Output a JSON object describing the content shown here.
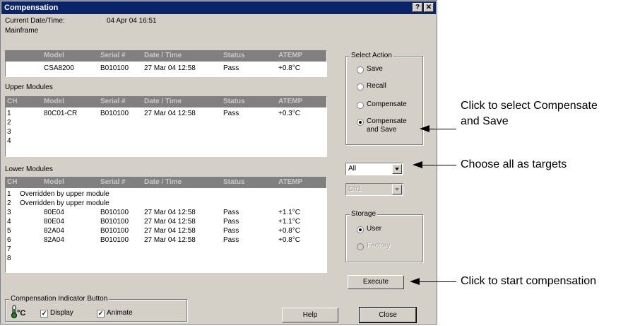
{
  "window": {
    "title": "Compensation",
    "help_glyph": "?",
    "close_glyph": "✕"
  },
  "datetime": {
    "label": "Current Date/Time:",
    "value": "04 Apr 04 16:51"
  },
  "mainframe": {
    "label": "Mainframe",
    "headers": [
      "Model",
      "Serial #",
      "Date / Time",
      "Status",
      "ATEMP"
    ],
    "rows": [
      [
        "CSA8200",
        "B010100",
        "27 Mar 04 12:58",
        "Pass",
        "+0.8°C"
      ]
    ]
  },
  "upper": {
    "label": "Upper Modules",
    "headers": [
      "CH",
      "Model",
      "Serial #",
      "Date / Time",
      "Status",
      "ATEMP"
    ],
    "rows": [
      [
        "1",
        "80C01-CR",
        "B010100",
        "27 Mar 04 12:58",
        "Pass",
        "+0.3°C"
      ],
      [
        "2",
        "",
        "",
        "",
        "",
        ""
      ],
      [
        "3",
        "",
        "",
        "",
        "",
        ""
      ],
      [
        "4",
        "",
        "",
        "",
        "",
        ""
      ]
    ]
  },
  "lower": {
    "label": "Lower Modules",
    "headers": [
      "CH",
      "Model",
      "Serial #",
      "Date / Time",
      "Status",
      "ATEMP"
    ],
    "overridden": "Overridden by upper module",
    "rows": [
      [
        "1",
        "",
        "",
        "",
        "",
        ""
      ],
      [
        "2",
        "",
        "",
        "",
        "",
        ""
      ],
      [
        "3",
        "80E04",
        "B010100",
        "27 Mar 04 12:58",
        "Pass",
        "+1.1°C"
      ],
      [
        "4",
        "80E04",
        "B010100",
        "27 Mar 04 12:58",
        "Pass",
        "+1.1°C"
      ],
      [
        "5",
        "82A04",
        "B010100",
        "27 Mar 04 12:58",
        "Pass",
        "+0.8°C"
      ],
      [
        "6",
        "82A04",
        "B010100",
        "27 Mar 04 12:58",
        "Pass",
        "+0.8°C"
      ],
      [
        "7",
        "",
        "",
        "",
        "",
        ""
      ],
      [
        "8",
        "",
        "",
        "",
        "",
        ""
      ]
    ]
  },
  "select_action": {
    "label": "Select Action",
    "options": [
      "Save",
      "Recall",
      "Compensate",
      "Compensate",
      "and Save"
    ],
    "selected": "Compensate and Save"
  },
  "target_combo": {
    "value": "All"
  },
  "channel_combo": {
    "value": "Ch1"
  },
  "storage": {
    "label": "Storage",
    "user": "User",
    "factory": "Factory",
    "selected": "User"
  },
  "buttons": {
    "execute": "Execute",
    "help": "Help",
    "close": "Close"
  },
  "indicator": {
    "label": "Compensation Indicator Button",
    "unit": "°C",
    "display": "Display",
    "animate": "Animate",
    "display_checked": true,
    "animate_checked": true,
    "check_glyph": "✓"
  },
  "callouts": {
    "compensate_line1": "Click to select Compensate",
    "compensate_line2": "and Save",
    "targets": "Choose all as targets",
    "start": "Click to start compensation"
  }
}
